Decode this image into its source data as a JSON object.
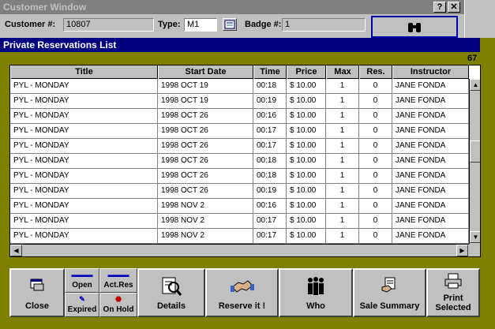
{
  "customer_window": {
    "title": "Customer Window",
    "help_btn": "?",
    "close_btn": "✕",
    "customer_label": "Customer #:",
    "customer_value": "10807",
    "type_label": "Type:",
    "type_value": "M1",
    "badge_label": "Badge #:",
    "badge_value": "1",
    "search_icon": "binoculars-icon"
  },
  "main": {
    "title": "Private Reservations List",
    "record_count": "67"
  },
  "grid": {
    "columns": [
      "Title",
      "Start Date",
      "Time",
      "Price",
      "Max",
      "Res.",
      "Instructor"
    ],
    "rows": [
      [
        "PYL - MONDAY",
        "1998 OCT 19",
        "00:18",
        "$ 10.00",
        "1",
        "0",
        "JANE FONDA"
      ],
      [
        "PYL - MONDAY",
        "1998 OCT 19",
        "00:19",
        "$ 10.00",
        "1",
        "0",
        "JANE FONDA"
      ],
      [
        "PYL - MONDAY",
        "1998 OCT 26",
        "00:16",
        "$ 10.00",
        "1",
        "0",
        "JANE FONDA"
      ],
      [
        "PYL - MONDAY",
        "1998 OCT 26",
        "00:17",
        "$ 10.00",
        "1",
        "0",
        "JANE FONDA"
      ],
      [
        "PYL - MONDAY",
        "1998 OCT 26",
        "00:17",
        "$ 10.00",
        "1",
        "0",
        "JANE FONDA"
      ],
      [
        "PYL - MONDAY",
        "1998 OCT 26",
        "00:18",
        "$ 10.00",
        "1",
        "0",
        "JANE FONDA"
      ],
      [
        "PYL - MONDAY",
        "1998 OCT 26",
        "00:18",
        "$ 10.00",
        "1",
        "0",
        "JANE FONDA"
      ],
      [
        "PYL - MONDAY",
        "1998 OCT 26",
        "00:19",
        "$ 10.00",
        "1",
        "0",
        "JANE FONDA"
      ],
      [
        "PYL - MONDAY",
        "1998 NOV 2",
        "00:16",
        "$ 10.00",
        "1",
        "0",
        "JANE FONDA"
      ],
      [
        "PYL - MONDAY",
        "1998 NOV 2",
        "00:17",
        "$ 10.00",
        "1",
        "0",
        "JANE FONDA"
      ],
      [
        "PYL - MONDAY",
        "1998 NOV 2",
        "00:17",
        "$ 10.00",
        "1",
        "0",
        "JANE FONDA"
      ]
    ]
  },
  "toolbar": {
    "close_label": "Close",
    "open_label": "Open",
    "expired_label": "Expired",
    "act_res_label": "Act.Res",
    "on_hold_label": "On Hold",
    "details_label": "Details",
    "reserve_label": "Reserve it !",
    "who_label": "Who",
    "sale_summary_label": "Sale Summary",
    "print_label_1": "Print",
    "print_label_2": "Selected"
  },
  "icons": {
    "close": "window-close-icon",
    "details": "magnifier-document-icon",
    "reserve": "handshake-icon",
    "who": "people-icon",
    "sale_summary": "hand-document-icon",
    "print": "printer-icon"
  },
  "colors": {
    "title_bar_active": "#000080",
    "title_bar_inactive": "#808080",
    "window_background": "#808000",
    "face": "#c0c0c0"
  }
}
